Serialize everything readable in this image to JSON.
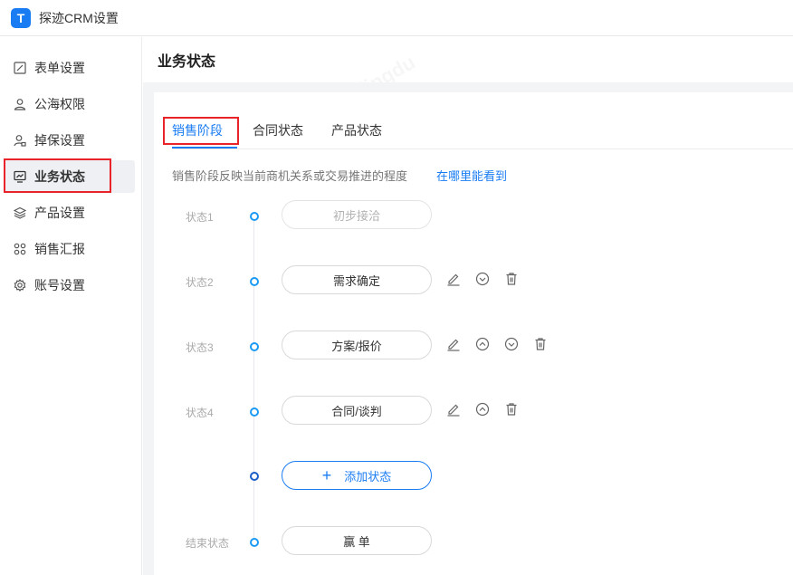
{
  "app": {
    "logo_letter": "T",
    "title": "探迹CRM设置"
  },
  "sidebar": {
    "items": [
      {
        "label": "表单设置",
        "icon": "form-edit-icon"
      },
      {
        "label": "公海权限",
        "icon": "user-icon"
      },
      {
        "label": "掉保设置",
        "icon": "user-lock-icon"
      },
      {
        "label": "业务状态",
        "icon": "monitor-chart-icon",
        "active": true
      },
      {
        "label": "产品设置",
        "icon": "layers-icon"
      },
      {
        "label": "销售汇报",
        "icon": "grid-icon"
      },
      {
        "label": "账号设置",
        "icon": "gear-icon"
      }
    ]
  },
  "main": {
    "title": "业务状态",
    "tabs": [
      {
        "label": "销售阶段",
        "active": true
      },
      {
        "label": "合同状态"
      },
      {
        "label": "产品状态"
      }
    ],
    "description": "销售阶段反映当前商机关系或交易推进的程度",
    "help_link": "在哪里能看到",
    "states": [
      {
        "label": "状态1",
        "name": "初步接洽",
        "disabled": true,
        "actions": []
      },
      {
        "label": "状态2",
        "name": "需求确定",
        "actions": [
          "edit-icon",
          "move-down-icon",
          "delete-icon"
        ]
      },
      {
        "label": "状态3",
        "name": "方案/报价",
        "actions": [
          "edit-icon",
          "move-up-icon",
          "move-down-icon",
          "delete-icon"
        ]
      },
      {
        "label": "状态4",
        "name": "合同/谈判",
        "actions": [
          "edit-icon",
          "move-up-icon",
          "delete-icon"
        ]
      }
    ],
    "add_button": {
      "plus": "+",
      "label": "添加状态"
    },
    "end_state": {
      "label": "结束状态",
      "name": "赢 单"
    }
  },
  "colors": {
    "accent": "#1a7cf3",
    "highlight_box": "#e8242a",
    "timeline_dot": "#1a9af3"
  }
}
